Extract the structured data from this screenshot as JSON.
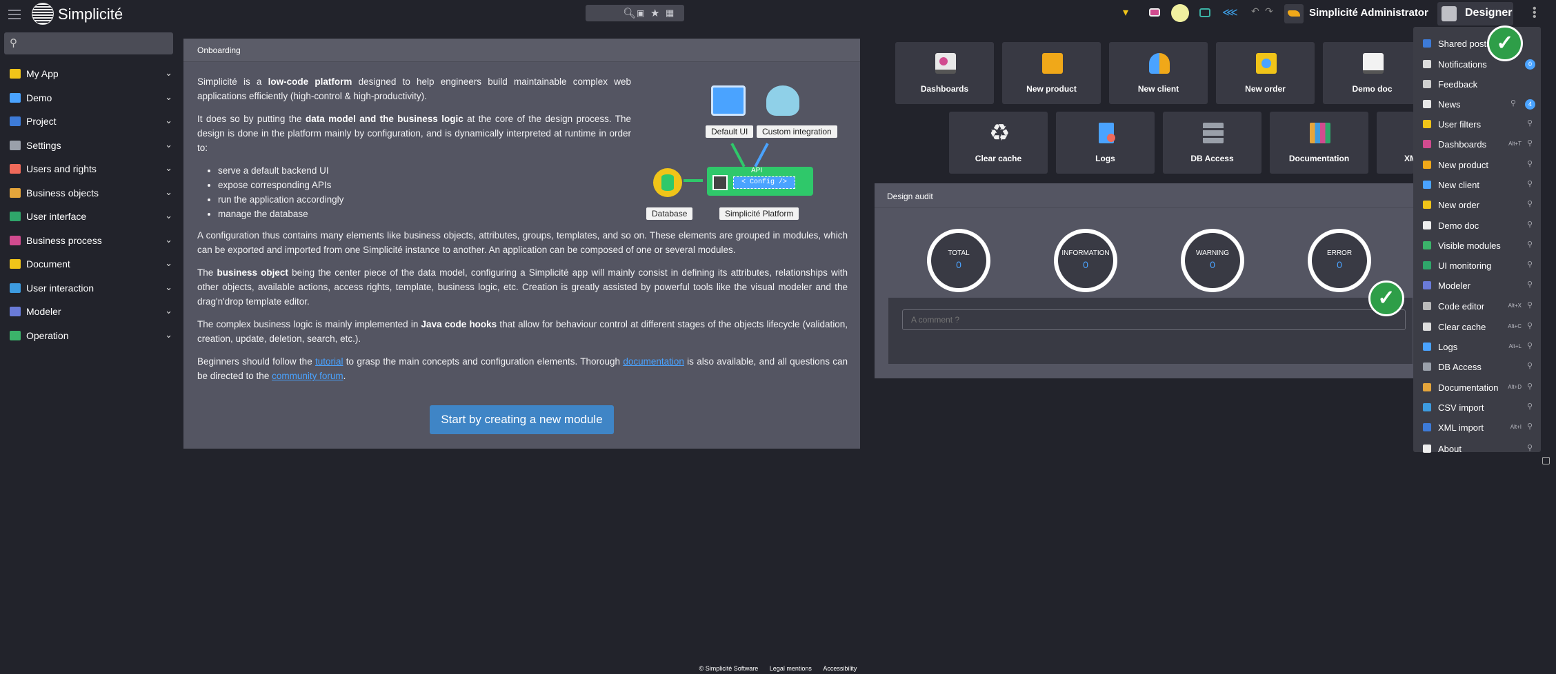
{
  "app": {
    "brand": "Simplicité",
    "admin_name": "Simplicité Administrator",
    "designer_label": "Designer"
  },
  "sidebar": {
    "items": [
      {
        "label": "My App",
        "color": "#f0c419"
      },
      {
        "label": "Demo",
        "color": "#4aa3ff"
      },
      {
        "label": "Project",
        "color": "#3d7bd8"
      },
      {
        "label": "Settings",
        "color": "#9aa0aa"
      },
      {
        "label": "Users and rights",
        "color": "#f06a5a"
      },
      {
        "label": "Business objects",
        "color": "#e5a53b"
      },
      {
        "label": "User interface",
        "color": "#2fa66a"
      },
      {
        "label": "Business process",
        "color": "#d14b8f"
      },
      {
        "label": "Document",
        "color": "#f0c419"
      },
      {
        "label": "User interaction",
        "color": "#3d9be0"
      },
      {
        "label": "Modeler",
        "color": "#6a7bd8"
      },
      {
        "label": "Operation",
        "color": "#3bb36a"
      }
    ]
  },
  "onboarding": {
    "title": "Onboarding",
    "p1_a": "Simplicité is a ",
    "p1_b": "low-code platform",
    "p1_c": " designed to help engineers build maintainable complex web applications efficiently (high-control & high-productivity).",
    "p2_a": "It does so by putting the ",
    "p2_b": "data model and the business logic",
    "p2_c": " at the core of the design process. The design is done in the platform mainly by configuration, and is dynamically interpreted at runtime in order to:",
    "bullets": [
      "serve a default backend UI",
      "expose corresponding APIs",
      "run the application accordingly",
      "manage the database"
    ],
    "p3": "A configuration thus contains many elements like business objects, attributes, groups, templates, and so on. These elements are grouped in modules, which can be exported and imported from one Simplicité instance to another. An application can be composed of one or several modules.",
    "p4_a": "The ",
    "p4_b": "business object",
    "p4_c": " being the center piece of the data model, configuring a Simplicité app will mainly consist in defining its attributes, relationships with other objects, available actions, access rights, template, business logic, etc. Creation is greatly assisted by powerful tools like the visual modeler and the drag'n'drop template editor.",
    "p5_a": "The complex business logic is mainly implemented in ",
    "p5_b": "Java code hooks",
    "p5_c": " that allow for behaviour control at different stages of the objects lifecycle (validation, creation, update, deletion, search, etc.).",
    "p6_a": "Beginners should follow the ",
    "p6_link1": "tutorial",
    "p6_b": " to grasp the main concepts and configuration elements. Thorough ",
    "p6_link2": "documentation",
    "p6_c": " is also available, and all questions can be directed to the ",
    "p6_link3": "community forum",
    "p6_d": ".",
    "button": "Start by creating a new module",
    "illus": {
      "default_ui": "Default UI",
      "custom": "Custom integration",
      "api": "API",
      "config": "< Config />",
      "database": "Database",
      "platform": "Simplicité Platform"
    }
  },
  "shortcuts": [
    "Dashboards",
    "New product",
    "New client",
    "New order",
    "Demo doc",
    "Clear cache",
    "Logs",
    "DB Access",
    "Documentation",
    "XM"
  ],
  "audit": {
    "title": "Design audit",
    "metrics": [
      {
        "label": "TOTAL",
        "value": "0"
      },
      {
        "label": "INFORMATION",
        "value": "0"
      },
      {
        "label": "WARNING",
        "value": "0"
      },
      {
        "label": "ERROR",
        "value": "0"
      }
    ],
    "comment_placeholder": "A comment ?"
  },
  "menu": {
    "items": [
      {
        "label": "Shared posts",
        "shortcut": "",
        "badge": "",
        "color": "#3d7bd8"
      },
      {
        "label": "Notifications",
        "shortcut": "",
        "badge": "0",
        "color": "#dddddd"
      },
      {
        "label": "Feedback",
        "shortcut": "",
        "badge": "",
        "color": "#cfcfcf"
      },
      {
        "label": "News",
        "shortcut": "",
        "badge": "4",
        "color": "#e8e8e8"
      },
      {
        "label": "User filters",
        "shortcut": "",
        "badge": "",
        "color": "#f0c419"
      },
      {
        "label": "Dashboards",
        "shortcut": "Alt+T",
        "badge": "",
        "color": "#d14b8f"
      },
      {
        "label": "New product",
        "shortcut": "",
        "badge": "",
        "color": "#f0a819"
      },
      {
        "label": "New client",
        "shortcut": "",
        "badge": "",
        "color": "#4aa3ff"
      },
      {
        "label": "New order",
        "shortcut": "",
        "badge": "",
        "color": "#f0c419"
      },
      {
        "label": "Demo doc",
        "shortcut": "",
        "badge": "",
        "color": "#eeeeee"
      },
      {
        "label": "Visible modules",
        "shortcut": "",
        "badge": "",
        "color": "#3bb36a"
      },
      {
        "label": "UI monitoring",
        "shortcut": "",
        "badge": "",
        "color": "#2fa66a"
      },
      {
        "label": "Modeler",
        "shortcut": "",
        "badge": "",
        "color": "#6a7bd8"
      },
      {
        "label": "Code editor",
        "shortcut": "Alt+X",
        "badge": "",
        "color": "#bbbbbb"
      },
      {
        "label": "Clear cache",
        "shortcut": "Alt+C",
        "badge": "",
        "color": "#dddddd"
      },
      {
        "label": "Logs",
        "shortcut": "Alt+L",
        "badge": "",
        "color": "#4aa3ff"
      },
      {
        "label": "DB Access",
        "shortcut": "",
        "badge": "",
        "color": "#9aa0aa"
      },
      {
        "label": "Documentation",
        "shortcut": "Alt+D",
        "badge": "",
        "color": "#e5a53b"
      },
      {
        "label": "CSV import",
        "shortcut": "",
        "badge": "",
        "color": "#3d9be0"
      },
      {
        "label": "XML import",
        "shortcut": "Alt+I",
        "badge": "",
        "color": "#3d7bd8"
      },
      {
        "label": "About",
        "shortcut": "",
        "badge": "",
        "color": "#eeeeee"
      }
    ]
  },
  "footer": {
    "copyright": "© Simplicité Software",
    "legal": "Legal mentions",
    "accessibility": "Accessibility"
  }
}
